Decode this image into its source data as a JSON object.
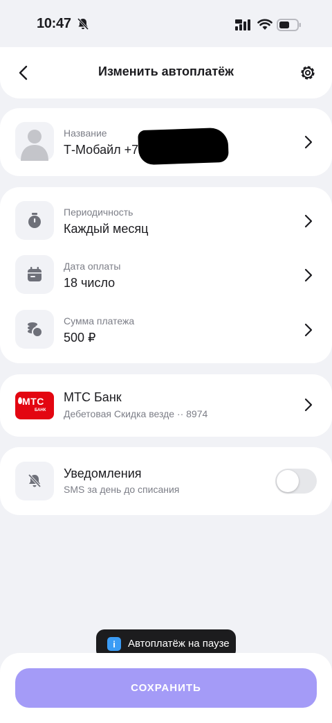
{
  "status_bar": {
    "time": "10:47"
  },
  "header": {
    "title": "Изменить автоплатёж"
  },
  "payee": {
    "label": "Название",
    "value": "Т-Мобайл +7 9"
  },
  "schedule": {
    "period": {
      "label": "Периодичность",
      "value": "Каждый месяц"
    },
    "date": {
      "label": "Дата оплаты",
      "value": "18 число"
    },
    "amount": {
      "label": "Сумма платежа",
      "value": "500 ₽"
    }
  },
  "bank": {
    "logo_text": "МТС",
    "logo_sub": "БАНК",
    "name": "МТС Банк",
    "card": "Дебетовая Скидка везде ·· 8974"
  },
  "notifications": {
    "title": "Уведомления",
    "subtitle": "SMS за день до списания",
    "enabled": false
  },
  "toast": {
    "text": "Автоплатёж на паузе",
    "icon": "info-icon"
  },
  "footer": {
    "save_label": "СОХРАНИТЬ"
  },
  "colors": {
    "accent": "#a49bf7",
    "background": "#f1f2f6",
    "mts_red": "#e30611",
    "toast_bg": "#1c1c1e",
    "info_blue": "#3b9cf5"
  }
}
